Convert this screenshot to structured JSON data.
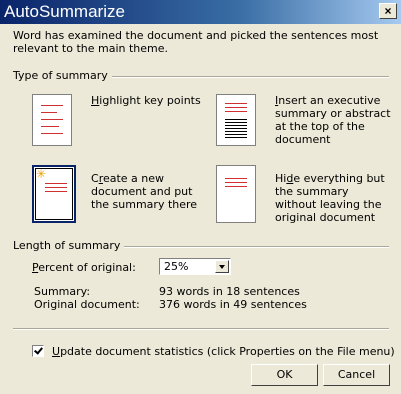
{
  "window": {
    "title": "AutoSummarize",
    "close_label": "×"
  },
  "intro": "Word has examined the document and picked the sentences most relevant to the main theme.",
  "type_group": {
    "label": "Type of summary",
    "options": [
      {
        "pre": "",
        "key": "H",
        "post": "ighlight key points",
        "selected": false
      },
      {
        "pre": "",
        "key": "I",
        "post": "nsert an executive summary or abstract at the top of the document",
        "selected": false
      },
      {
        "pre": "C",
        "key": "r",
        "post": "eate a new document and put the summary there",
        "selected": true
      },
      {
        "pre": "Hi",
        "key": "d",
        "post": "e everything but the summary without leaving the original document",
        "selected": false
      }
    ]
  },
  "length_group": {
    "label": "Length of summary",
    "percent_label_key": "P",
    "percent_label_rest": "ercent of original:",
    "percent_value": "25%",
    "summary_label": "Summary:",
    "summary_value": "93 words in 18 sentences",
    "original_label": "Original document:",
    "original_value": "376 words in 49 sentences"
  },
  "update_stats": {
    "checked": true,
    "key": "U",
    "rest": "pdate document statistics (click Properties on the File menu)"
  },
  "buttons": {
    "ok": "OK",
    "cancel": "Cancel"
  }
}
